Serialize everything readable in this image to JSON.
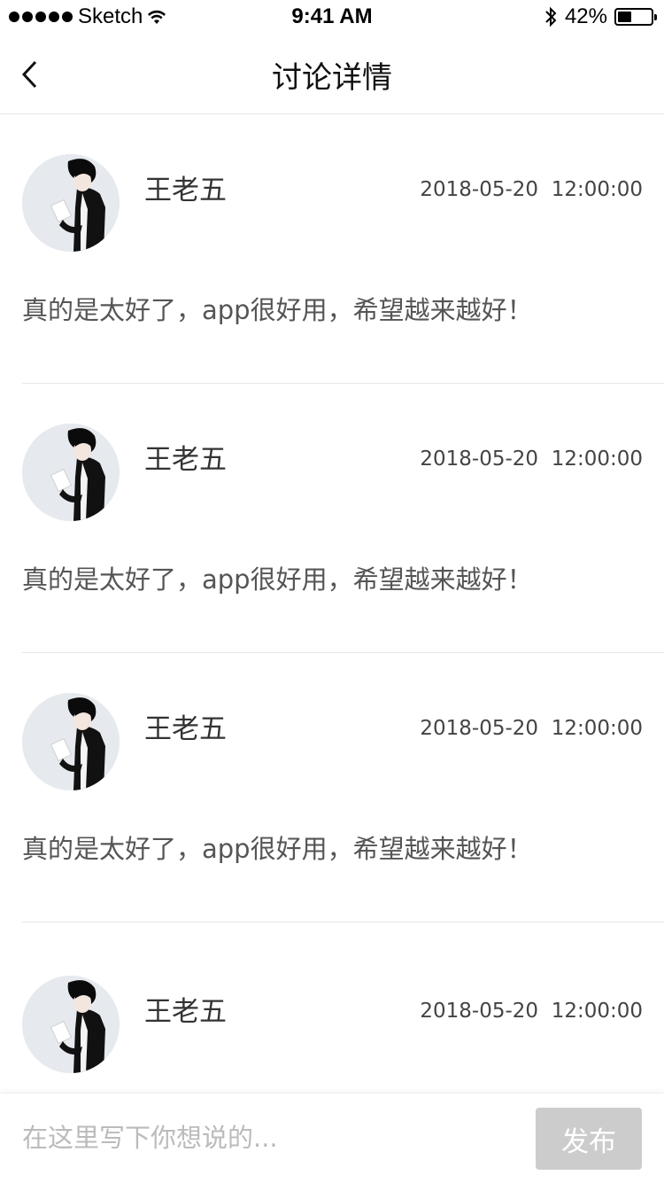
{
  "status_bar": {
    "carrier": "Sketch",
    "time": "9:41 AM",
    "battery_percent": "42%",
    "battery_level": 0.42,
    "icons": [
      "signal-dots-icon",
      "wifi-icon",
      "bluetooth-icon",
      "battery-icon"
    ]
  },
  "nav": {
    "back_icon": "chevron-left-icon",
    "title": "讨论详情"
  },
  "comments": [
    {
      "user": "王老五",
      "date": "2018-05-20",
      "time": "12:00:00",
      "text": "真的是太好了，app很好用，希望越来越好！"
    },
    {
      "user": "王老五",
      "date": "2018-05-20",
      "time": "12:00:00",
      "text": "真的是太好了，app很好用，希望越来越好！"
    },
    {
      "user": "王老五",
      "date": "2018-05-20",
      "time": "12:00:00",
      "text": "真的是太好了，app很好用，希望越来越好！"
    },
    {
      "user": "王老五",
      "date": "2018-05-20",
      "time": "12:00:00",
      "text": ""
    }
  ],
  "composer": {
    "placeholder": "在这里写下你想说的...",
    "value": "",
    "publish_label": "发布",
    "publish_color": "#cccccc"
  }
}
